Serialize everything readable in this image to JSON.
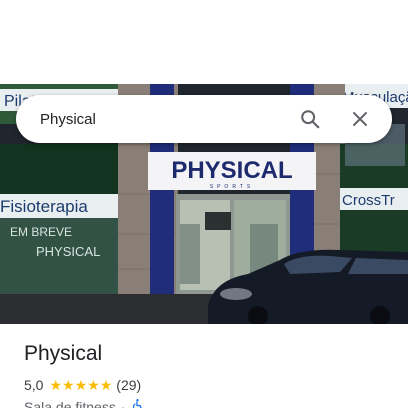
{
  "search": {
    "value": "Physical"
  },
  "photo": {
    "sign_text": "PHYSICAL",
    "sign_subtext": "SPORTS",
    "left_banner": "Fisioterapia",
    "window_text_1": "EM BREVE",
    "window_text_2": "PHYSICAL",
    "right_banner": "CrossTr",
    "top_left_text": "Pilates",
    "top_right_text": "Musculação"
  },
  "place": {
    "title": "Physical",
    "rating": "5,0",
    "stars": 5,
    "review_count": "(29)",
    "category": "Sala de fitness",
    "separator": "·"
  },
  "colors": {
    "star": "#fbbc04",
    "accessibility_icon": "#1a73e8",
    "title": "#202124"
  },
  "icons": {
    "search": "search-icon",
    "close": "close-icon",
    "accessibility": "wheelchair-icon"
  }
}
